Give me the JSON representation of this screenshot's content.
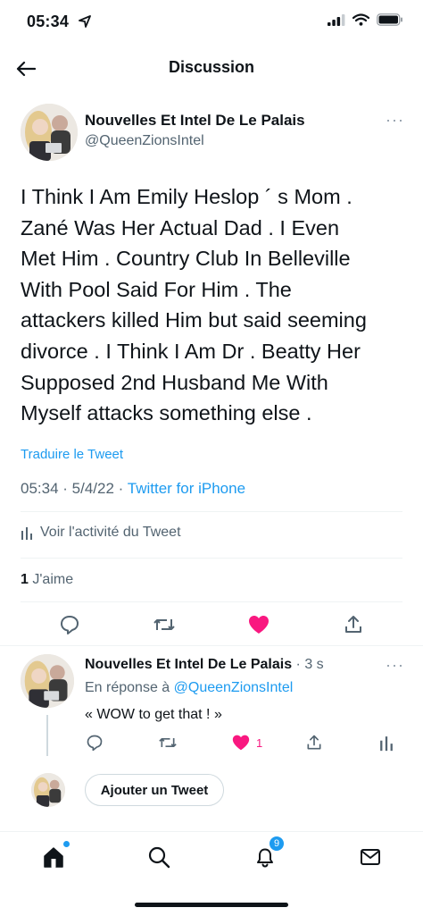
{
  "status_bar": {
    "time": "05:34"
  },
  "header": {
    "title": "Discussion"
  },
  "tweet": {
    "author_name": "Nouvelles Et Intel De Le Palais",
    "author_handle": "@QueenZionsIntel",
    "lines": [
      "I Think I Am Emily Heslop ´ s Mom .",
      "Zané Was Her Actual Dad .  I Even",
      "Met Him .  Country Club In Belleville",
      "With Pool Said For Him .  The",
      "attackers killed Him but said seeming",
      "divorce .  I Think I Am Dr . Beatty Her",
      "Supposed 2nd Husband Me With",
      "Myself attacks something else ."
    ],
    "translate_label": "Traduire le Tweet",
    "time": "05:34",
    "date": "5/4/22",
    "source": "Twitter for iPhone",
    "activity_label": "Voir l'activité du Tweet",
    "like_count": "1",
    "like_label": "J'aime"
  },
  "reply": {
    "author_name": "Nouvelles Et Intel De Le Palais",
    "time_ago": "3 s",
    "in_reply_prefix": "En réponse à",
    "in_reply_handle": "@QueenZionsIntel",
    "text": "« WOW to get that ! »",
    "like_count": "1"
  },
  "compose": {
    "label": "Ajouter un Tweet"
  },
  "tabbar": {
    "notifications_badge": "9"
  },
  "colors": {
    "accent": "#1d9bf0",
    "like": "#f91880",
    "secondary_text": "#536471"
  }
}
